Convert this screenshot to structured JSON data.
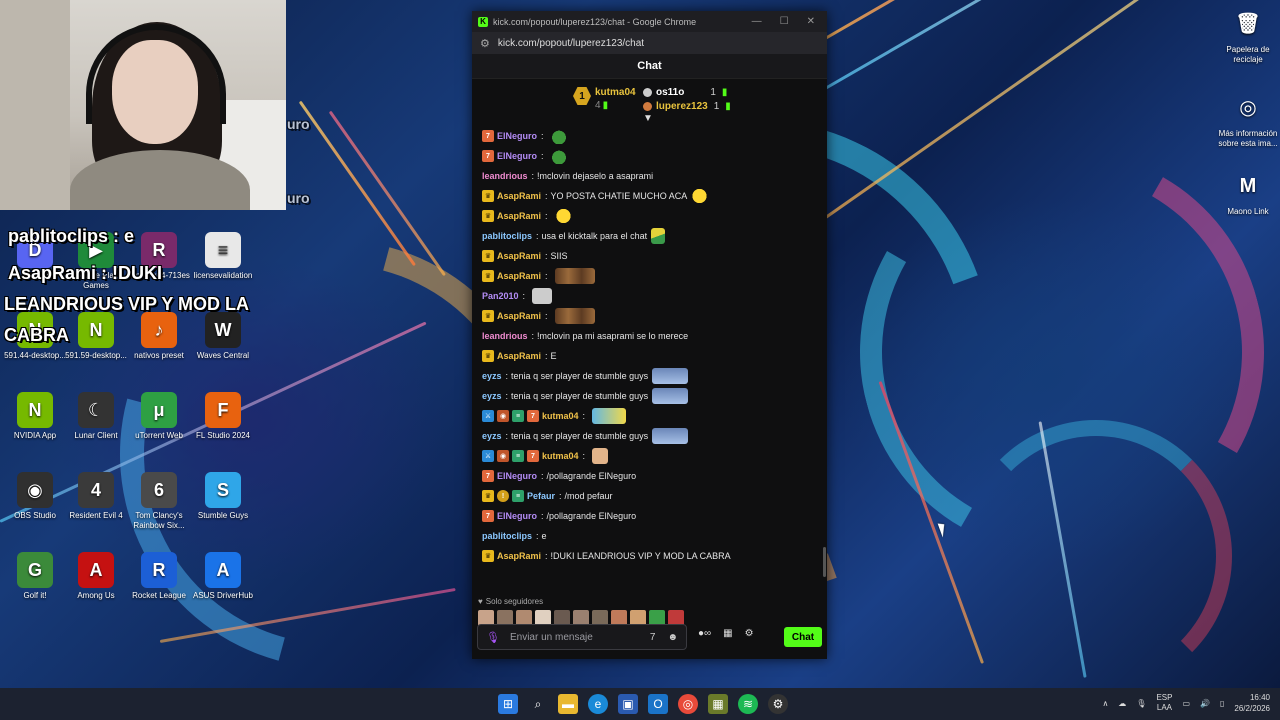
{
  "window": {
    "title": "kick.com/popout/luperez123/chat - Google Chrome",
    "url": "kick.com/popout/luperez123/chat",
    "header": "Chat"
  },
  "leaderboard": {
    "top": {
      "rank": "1",
      "name": "kutma04",
      "count": "4"
    },
    "second": {
      "name": "os11o",
      "count": "1"
    },
    "third": {
      "name": "luperez123",
      "count": "1"
    }
  },
  "messages": [
    {
      "badges": [
        "7tv"
      ],
      "user": "ElNeguro",
      "color": "#b48cf5",
      "text": "",
      "emote": "pepe"
    },
    {
      "badges": [
        "7tv"
      ],
      "user": "ElNeguro",
      "color": "#b48cf5",
      "text": "",
      "emote": "pepe"
    },
    {
      "badges": [],
      "user": "leandrious",
      "color": "#f08bd0",
      "text": "!mclovin dejaselo a asaprami",
      "emote": ""
    },
    {
      "badges": [
        "crown"
      ],
      "user": "AsapRami",
      "color": "#f1c24a",
      "text": "YO POSTA CHATIE MUCHO ACA",
      "emote": "smile"
    },
    {
      "badges": [
        "crown"
      ],
      "user": "AsapRami",
      "color": "#f1c24a",
      "text": "",
      "emote": "smile"
    },
    {
      "badges": [],
      "user": "pablitoclips",
      "color": "#8cc8ff",
      "text": "usa el kicktalk para el chat",
      "emote": "hat"
    },
    {
      "badges": [
        "crown"
      ],
      "user": "AsapRami",
      "color": "#f1c24a",
      "text": "SIIS",
      "emote": ""
    },
    {
      "badges": [
        "crown"
      ],
      "user": "AsapRami",
      "color": "#f1c24a",
      "text": "",
      "emote": "cat"
    },
    {
      "badges": [],
      "user": "Pan2010",
      "color": "#b48cf5",
      "text": "",
      "emote": "face"
    },
    {
      "badges": [
        "crown"
      ],
      "user": "AsapRami",
      "color": "#f1c24a",
      "text": "",
      "emote": "cat"
    },
    {
      "badges": [],
      "user": "leandrious",
      "color": "#f08bd0",
      "text": "!mclovin pa mi asaprami se lo merece",
      "emote": ""
    },
    {
      "badges": [
        "crown"
      ],
      "user": "AsapRami",
      "color": "#f1c24a",
      "text": "E",
      "emote": ""
    },
    {
      "badges": [],
      "user": "eyzs",
      "color": "#8cc8ff",
      "text": "tenia q ser player de stumble guys",
      "emote": "sg"
    },
    {
      "badges": [],
      "user": "eyzs",
      "color": "#8cc8ff",
      "text": "tenia q ser player de stumble guys",
      "emote": "sg"
    },
    {
      "badges": [
        "blue",
        "og",
        "green",
        "7tv"
      ],
      "user": "kutma04",
      "color": "#f1c24a",
      "text": "",
      "emote": "bird"
    },
    {
      "badges": [],
      "user": "eyzs",
      "color": "#8cc8ff",
      "text": "tenia q ser player de stumble guys",
      "emote": "sg"
    },
    {
      "badges": [
        "blue",
        "og",
        "green",
        "7tv"
      ],
      "user": "kutma04",
      "color": "#f1c24a",
      "text": "",
      "emote": "hand"
    },
    {
      "badges": [
        "7tv"
      ],
      "user": "ElNeguro",
      "color": "#b48cf5",
      "text": "/pollagrande ElNeguro",
      "emote": ""
    },
    {
      "badges": [
        "crown",
        "gold",
        "green"
      ],
      "user": "Pefaur",
      "color": "#8cc8ff",
      "text": "/mod pefaur",
      "emote": ""
    },
    {
      "badges": [
        "7tv"
      ],
      "user": "ElNeguro",
      "color": "#b48cf5",
      "text": "/pollagrande ElNeguro",
      "emote": ""
    },
    {
      "badges": [],
      "user": "pablitoclips",
      "color": "#8cc8ff",
      "text": "e",
      "emote": ""
    },
    {
      "badges": [
        "crown"
      ],
      "user": "AsapRami",
      "color": "#f1c24a",
      "text": "!DUKI LEANDRIOUS VIP Y MOD LA CABRA",
      "emote": ""
    }
  ],
  "followers_label": "Solo seguidores",
  "composer": {
    "placeholder": "Enviar un mensaje",
    "send_label": "Chat"
  },
  "overlay": {
    "line1": "pablitoclips : e",
    "line2": "AsapRami : !DUKI",
    "line3": "LEANDRIOUS VIP Y MOD LA",
    "line4": "CABRA",
    "wm1": "uro",
    "wm2": "uro"
  },
  "desktop_icons": [
    {
      "label": "Discord",
      "color": "#5865f2",
      "glyph": "D"
    },
    {
      "label": "Google Play Games",
      "color": "#1f8a3a",
      "glyph": "▶"
    },
    {
      "label": "winrar-x64-713es",
      "color": "#7a2a6a",
      "glyph": "R"
    },
    {
      "label": "licensevalidation",
      "color": "#e8e8e8",
      "glyph": "≡"
    },
    {
      "label": "591.44-desktop...",
      "color": "#76b900",
      "glyph": "N"
    },
    {
      "label": "591.59-desktop...",
      "color": "#76b900",
      "glyph": "N"
    },
    {
      "label": "nativos preset",
      "color": "#e8620f",
      "glyph": "♪"
    },
    {
      "label": "Waves Central",
      "color": "#222222",
      "glyph": "W"
    },
    {
      "label": "NVIDIA App",
      "color": "#76b900",
      "glyph": "N"
    },
    {
      "label": "Lunar Client",
      "color": "#333333",
      "glyph": "☾"
    },
    {
      "label": "uTorrent Web",
      "color": "#2ea043",
      "glyph": "μ"
    },
    {
      "label": "FL Studio 2024",
      "color": "#e8620f",
      "glyph": "F"
    },
    {
      "label": "OBS Studio",
      "color": "#303030",
      "glyph": "◉"
    },
    {
      "label": "Resident Evil 4",
      "color": "#3a3a3a",
      "glyph": "4"
    },
    {
      "label": "Tom Clancy's Rainbow Six...",
      "color": "#4a4a4a",
      "glyph": "6"
    },
    {
      "label": "Stumble Guys",
      "color": "#2fa6e8",
      "glyph": "S"
    },
    {
      "label": "Golf it!",
      "color": "#3b8a3a",
      "glyph": "G"
    },
    {
      "label": "Among Us",
      "color": "#c51111",
      "glyph": "A"
    },
    {
      "label": "Rocket League",
      "color": "#1c5fd6",
      "glyph": "R"
    },
    {
      "label": "ASUS DriverHub",
      "color": "#1a73e8",
      "glyph": "A"
    }
  ],
  "right_icons": [
    {
      "label": "Papelera de reciclaje",
      "glyph": "🗑"
    },
    {
      "label": "Más información sobre esta ima...",
      "glyph": "◎"
    },
    {
      "label": "Maono Link",
      "glyph": "M"
    }
  ],
  "taskbar": {
    "lang1": "ESP",
    "lang2": "LAA",
    "time": "16:40",
    "date": "26/2/2026"
  }
}
